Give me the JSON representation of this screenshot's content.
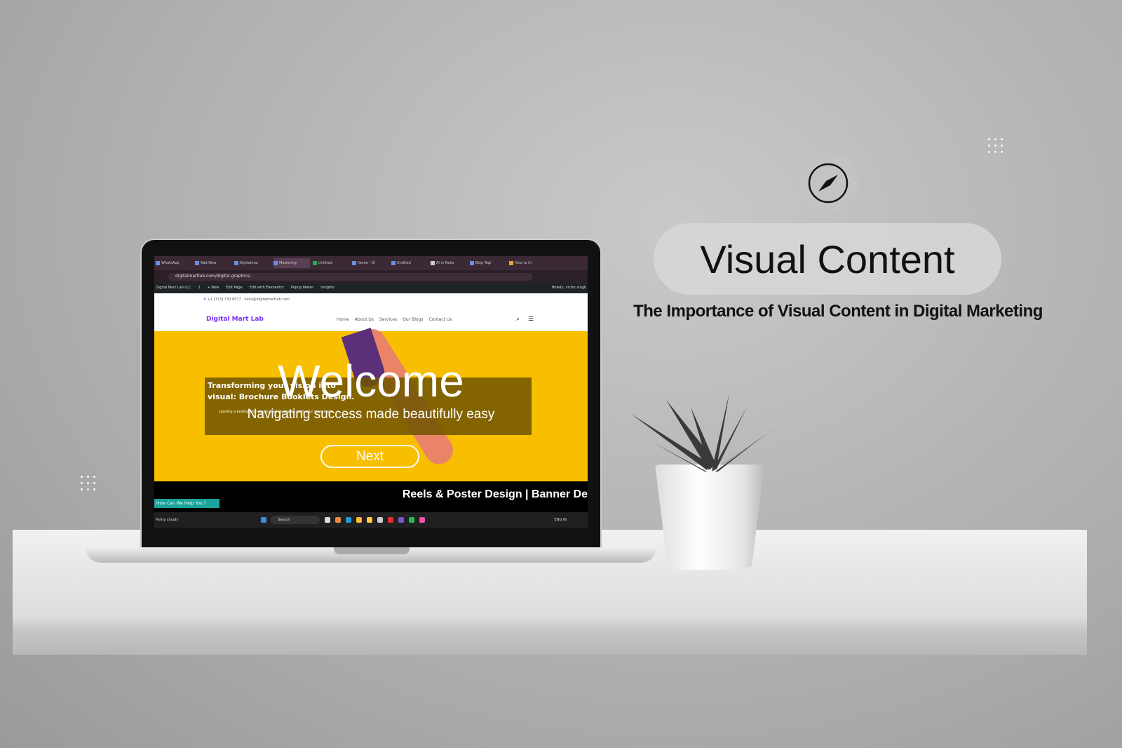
{
  "heading": {
    "title": "Visual Content",
    "subtitle": "The Importance of Visual Content in Digital Marketing",
    "compass_icon": "compass-icon"
  },
  "browser": {
    "tabs": [
      "WhatsApp",
      "Add New",
      "Digitalmar",
      "Mastering",
      "Untitled",
      "Home - Di",
      "Untitled",
      "AI in Netw",
      "Blog Topi",
      "How to Cr"
    ],
    "active_tab": 3,
    "url": "digitalmartlab.com/digital-graphics/"
  },
  "admin_bar": {
    "items": [
      "Digital Mart Lab LLC",
      "1",
      "+ New",
      "Edit Page",
      "Edit with Elementor",
      "Popup Maker",
      "Insights"
    ],
    "greeting": "Howdy, victor singh"
  },
  "site": {
    "phone": "+1 (713) 730 8577",
    "email": "hello@digitalmartlab.com",
    "logo": "Digital Mart Lab",
    "nav": [
      "Home",
      "About Us",
      "Services",
      "Our Blogs",
      "Contact Us"
    ],
    "hero_behind": "Transforming your vision into visual: Brochure Booklets Design.",
    "hero_small": "Leaving a lasting impression that resonates with your customers",
    "welcome": "Welcome",
    "tagline": "Navigating success made beautifully easy",
    "next": "Next",
    "marquee": "Reels & Poster Design | Banner De",
    "help": "How Can We Help You ?"
  },
  "taskbar": {
    "weather": "Partly cloudy",
    "search": "Search",
    "lang": "ENG IN"
  },
  "colors": {
    "hero": "#f8be00",
    "help": "#1aa39a",
    "logo": "#7b2ff7"
  }
}
